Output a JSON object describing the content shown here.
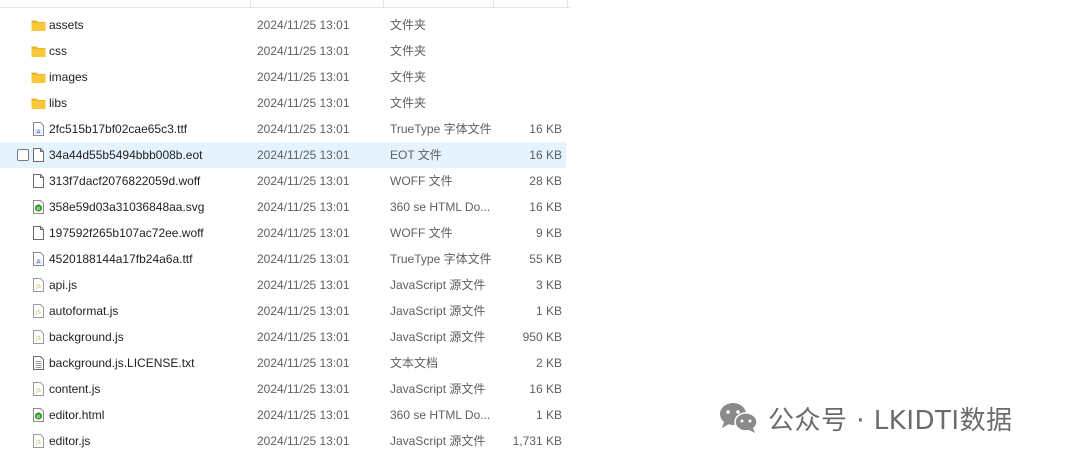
{
  "files": [
    {
      "name": "assets",
      "date": "2024/11/25 13:01",
      "type": "文件夹",
      "size": "",
      "icon": "folder-icon"
    },
    {
      "name": "css",
      "date": "2024/11/25 13:01",
      "type": "文件夹",
      "size": "",
      "icon": "folder-icon"
    },
    {
      "name": "images",
      "date": "2024/11/25 13:01",
      "type": "文件夹",
      "size": "",
      "icon": "folder-icon"
    },
    {
      "name": "libs",
      "date": "2024/11/25 13:01",
      "type": "文件夹",
      "size": "",
      "icon": "folder-icon"
    },
    {
      "name": "2fc515b17bf02cae65c3.ttf",
      "date": "2024/11/25 13:01",
      "type": "TrueType 字体文件",
      "size": "16 KB",
      "icon": "font-file-icon"
    },
    {
      "name": "34a44d55b5494bbb008b.eot",
      "date": "2024/11/25 13:01",
      "type": "EOT 文件",
      "size": "16 KB",
      "icon": "blank-file-icon"
    },
    {
      "name": "313f7dacf2076822059d.woff",
      "date": "2024/11/25 13:01",
      "type": "WOFF 文件",
      "size": "28 KB",
      "icon": "blank-file-icon"
    },
    {
      "name": "358e59d03a31036848aa.svg",
      "date": "2024/11/25 13:01",
      "type": "360 se HTML Do...",
      "size": "16 KB",
      "icon": "browser-file-icon"
    },
    {
      "name": "197592f265b107ac72ee.woff",
      "date": "2024/11/25 13:01",
      "type": "WOFF 文件",
      "size": "9 KB",
      "icon": "blank-file-icon"
    },
    {
      "name": "4520188144a17fb24a6a.ttf",
      "date": "2024/11/25 13:01",
      "type": "TrueType 字体文件",
      "size": "55 KB",
      "icon": "font-file-icon"
    },
    {
      "name": "api.js",
      "date": "2024/11/25 13:01",
      "type": "JavaScript 源文件",
      "size": "3 KB",
      "icon": "js-file-icon"
    },
    {
      "name": "autoformat.js",
      "date": "2024/11/25 13:01",
      "type": "JavaScript 源文件",
      "size": "1 KB",
      "icon": "js-file-icon"
    },
    {
      "name": "background.js",
      "date": "2024/11/25 13:01",
      "type": "JavaScript 源文件",
      "size": "950 KB",
      "icon": "js-file-icon"
    },
    {
      "name": "background.js.LICENSE.txt",
      "date": "2024/11/25 13:01",
      "type": "文本文档",
      "size": "2 KB",
      "icon": "text-file-icon"
    },
    {
      "name": "content.js",
      "date": "2024/11/25 13:01",
      "type": "JavaScript 源文件",
      "size": "16 KB",
      "icon": "js-file-icon"
    },
    {
      "name": "editor.html",
      "date": "2024/11/25 13:01",
      "type": "360 se HTML Do...",
      "size": "1 KB",
      "icon": "browser-file-icon"
    },
    {
      "name": "editor.js",
      "date": "2024/11/25 13:01",
      "type": "JavaScript 源文件",
      "size": "1,731 KB",
      "icon": "js-file-icon"
    }
  ],
  "hover_row": 5,
  "watermark": {
    "text": "公众号 · LKIDTI数据",
    "icon": "wechat-icon"
  },
  "colors": {
    "folder": "#f8c83a",
    "hover": "#e5f3ff",
    "js_icon": "#c9b23a",
    "browser_icon": "#3a9b2e",
    "font_icon": "#2a5fb0"
  }
}
